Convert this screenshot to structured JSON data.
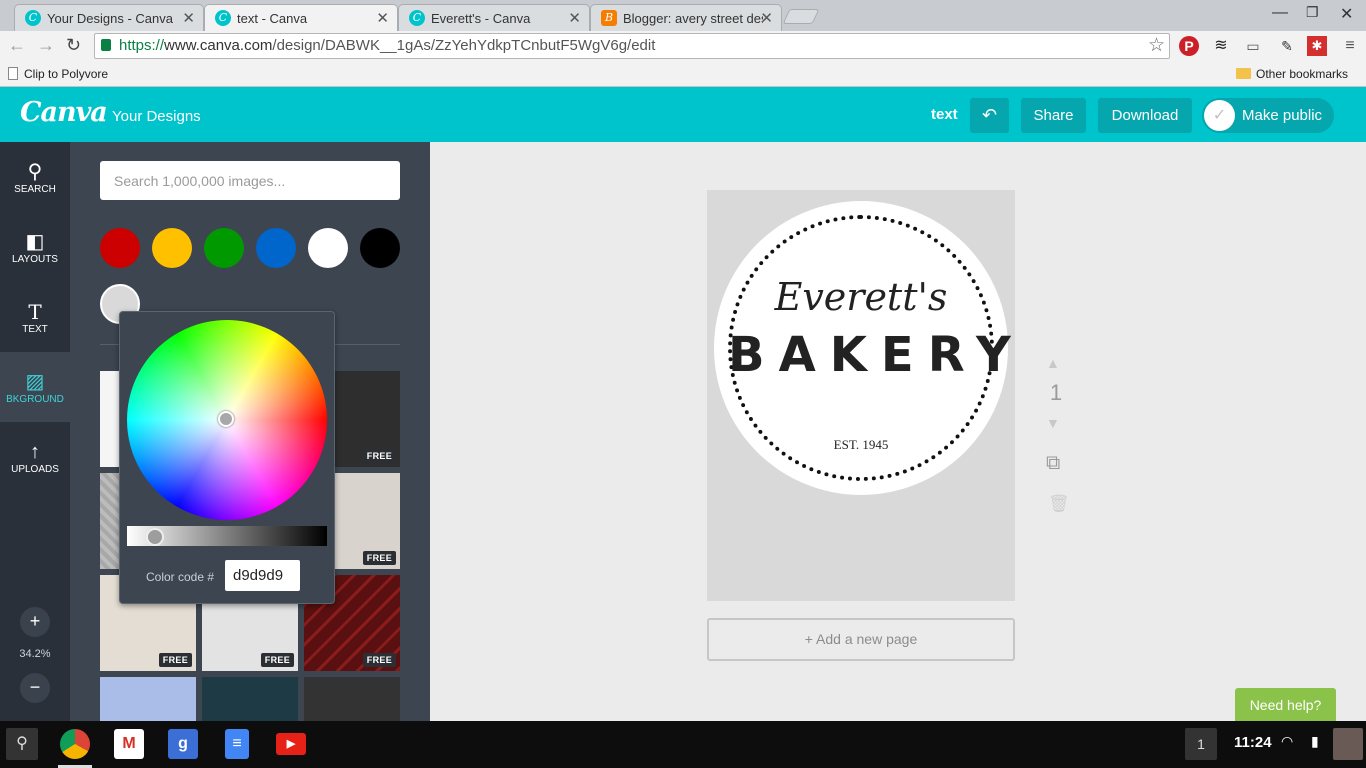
{
  "browser": {
    "tabs": [
      {
        "title": "Your Designs - Canva",
        "favicon": "canva-icon",
        "active": false
      },
      {
        "title": "text - Canva",
        "favicon": "canva-icon",
        "active": true
      },
      {
        "title": "Everett's - Canva",
        "favicon": "canva-icon",
        "active": false
      },
      {
        "title": "Blogger: avery street des",
        "favicon": "blogger-icon",
        "active": false
      }
    ],
    "url_scheme": "https://",
    "url_host": "www.canva.com",
    "url_path": "/design/DABWK__1gAs/ZzYehYdkpTCnbutF5WgV6g/edit",
    "bookmarks": {
      "left": "Clip to Polyvore",
      "right": "Other bookmarks"
    }
  },
  "header": {
    "logo": "Canva",
    "your_designs": "Your Designs",
    "doc_name": "text",
    "share": "Share",
    "download": "Download",
    "make_public": "Make public"
  },
  "nav": {
    "search": "SEARCH",
    "layouts": "LAYOUTS",
    "text": "TEXT",
    "background": "BKGROUND",
    "uploads": "UPLOADS",
    "zoom": "34.2%"
  },
  "panel": {
    "search_placeholder": "Search 1,000,000 images...",
    "swatches": [
      "#cc0000",
      "#ffc000",
      "#009900",
      "#0066cc",
      "#ffffff",
      "#000000",
      "#d9d9d9"
    ],
    "free_label": "FREE"
  },
  "picker": {
    "code_label": "Color code #",
    "code_value": "d9d9d9"
  },
  "canvas": {
    "script_text": "Everett's",
    "main_text": "BAKERY",
    "est_text": "EST. 1945",
    "page_number": "1",
    "add_page": "+ Add a new page",
    "background_color": "#d9d9d9"
  },
  "help": "Need help?",
  "shelf": {
    "notifications": "1",
    "clock": "11:24"
  },
  "colors": {
    "accent": "#00c4cc",
    "nav_bg": "#293039",
    "panel_bg": "#3c4550",
    "help_green": "#8bc34a"
  }
}
